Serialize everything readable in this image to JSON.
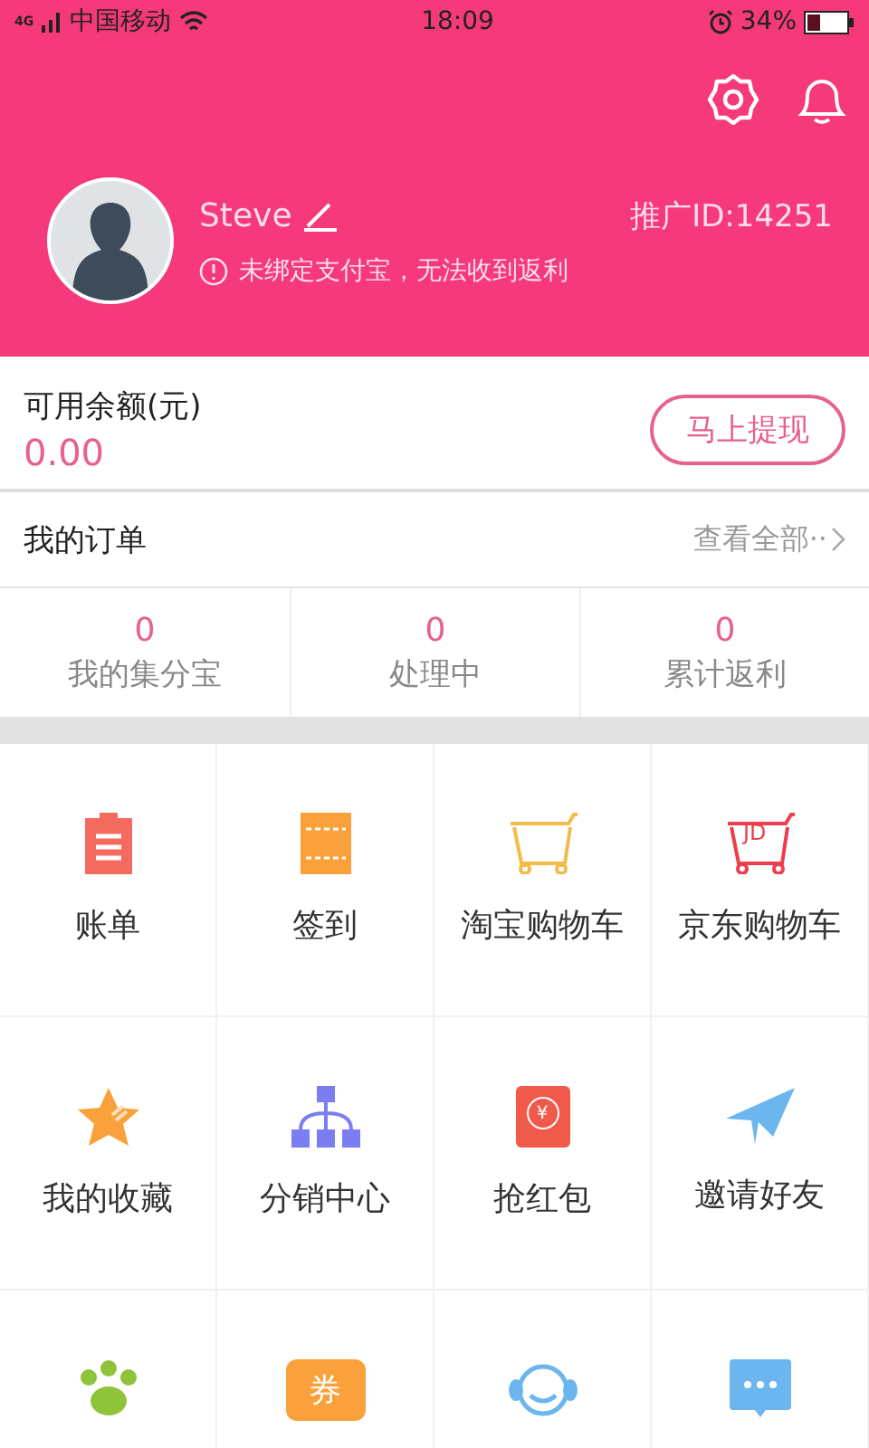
{
  "status_bar": {
    "network": "4G",
    "carrier": "中国移动",
    "time": "18:09",
    "battery": "34%"
  },
  "profile": {
    "name": "Steve",
    "promo_id": "推广ID:14251",
    "warning": "未绑定支付宝，无法收到返利"
  },
  "balance": {
    "label": "可用余额(元)",
    "amount": "0.00",
    "button": "马上提现"
  },
  "orders": {
    "title": "我的订单",
    "view_all": "查看全部··"
  },
  "stats": [
    {
      "value": "0",
      "label": "我的集分宝"
    },
    {
      "value": "0",
      "label": "处理中"
    },
    {
      "value": "0",
      "label": "累计返利"
    }
  ],
  "grid": [
    {
      "kind": "clipboard",
      "label": "账单"
    },
    {
      "kind": "ticket",
      "label": "签到"
    },
    {
      "kind": "cart",
      "label": "淘宝购物车"
    },
    {
      "kind": "cart-tag",
      "icon_text": "JD",
      "label": "京东购物车"
    },
    {
      "kind": "star",
      "label": "我的收藏"
    },
    {
      "kind": "hierarchy",
      "label": "分销中心"
    },
    {
      "kind": "envelope",
      "icon_text": "¥",
      "label": "抢红包"
    },
    {
      "kind": "plane",
      "label": "邀请好友"
    },
    {
      "kind": "paw"
    },
    {
      "kind": "coupon",
      "icon_text": "券"
    },
    {
      "kind": "headset"
    },
    {
      "kind": "chat"
    }
  ]
}
